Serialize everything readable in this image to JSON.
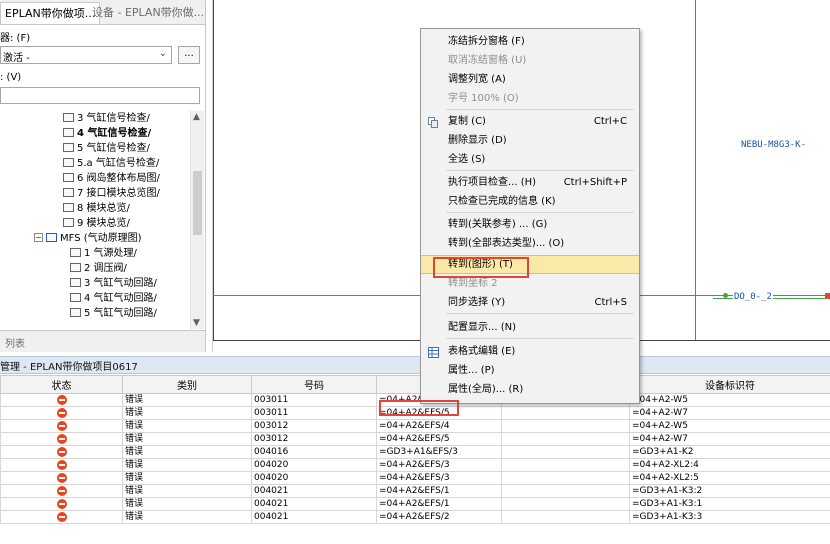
{
  "nav": {
    "tab_active": "EPLAN带你做项...",
    "tab_inactive": "设备 - EPLAN带你做...",
    "filter_label": "器: (F)",
    "filter_value": "激活 -",
    "filter_button": "...",
    "value_label": ": (V)",
    "value_input": "",
    "tree": [
      {
        "label": "3 气缸信号检查/",
        "bold": false,
        "icon": "page-icon"
      },
      {
        "label": "4 气缸信号检查/",
        "bold": true,
        "icon": "page-icon"
      },
      {
        "label": "5 气缸信号检查/",
        "bold": false,
        "icon": "page-icon"
      },
      {
        "label": "5.a 气缸信号检查/",
        "bold": false,
        "icon": "page-icon"
      },
      {
        "label": "6 阀岛整体布局图/",
        "bold": false,
        "icon": "grid-page-icon"
      },
      {
        "label": "7 接口模块总览图/",
        "bold": false,
        "icon": "grid-page-icon"
      },
      {
        "label": "8 模块总览/",
        "bold": false,
        "icon": "grid-page-icon"
      },
      {
        "label": "9 模块总览/",
        "bold": false,
        "icon": "grid-page-icon"
      },
      {
        "label": "MFS (气动原理图)",
        "bold": false,
        "icon": "structure-icon",
        "group": true
      },
      {
        "label": "1 气源处理/",
        "bold": false,
        "icon": "page-icon"
      },
      {
        "label": "2 调压阀/",
        "bold": false,
        "icon": "page-icon"
      },
      {
        "label": "3 气缸气动回路/",
        "bold": false,
        "icon": "page-icon"
      },
      {
        "label": "4 气缸气动回路/",
        "bold": false,
        "icon": "page-icon"
      },
      {
        "label": "5 气缸气动回路/",
        "bold": false,
        "icon": "page-icon"
      }
    ],
    "bottom_tab": "列表"
  },
  "canvas": {
    "device_label": "NEBU-M8G3-K-",
    "line_label": "DO_0-_2"
  },
  "messages": {
    "title": "管理 - EPLAN带你做项目0617",
    "columns": [
      "状态",
      "类别",
      "号码",
      "",
      "",
      "设备标识符"
    ],
    "rows": [
      {
        "category": "错误",
        "number": "003011",
        "text": "=04+A2&EFS/4",
        "device": "=04+A2-W5"
      },
      {
        "category": "错误",
        "number": "003011",
        "text": "=04+A2&EFS/5",
        "device": "=04+A2-W7"
      },
      {
        "category": "错误",
        "number": "003012",
        "text": "=04+A2&EFS/4",
        "device": "=04+A2-W5"
      },
      {
        "category": "错误",
        "number": "003012",
        "text": "=04+A2&EFS/5",
        "device": "=04+A2-W7"
      },
      {
        "category": "错误",
        "number": "004016",
        "text": "=GD3+A1&EFS/3",
        "device": "=GD3+A1-K2"
      },
      {
        "category": "错误",
        "number": "004020",
        "text": "=04+A2&EFS/3",
        "device": "=04+A2-XL2:4"
      },
      {
        "category": "错误",
        "number": "004020",
        "text": "=04+A2&EFS/3",
        "device": "=04+A2-XL2:5"
      },
      {
        "category": "错误",
        "number": "004021",
        "text": "=04+A2&EFS/1",
        "device": "=GD3+A1-K3:2"
      },
      {
        "category": "错误",
        "number": "004021",
        "text": "=04+A2&EFS/1",
        "device": "=GD3+A1-K3:1"
      },
      {
        "category": "错误",
        "number": "004021",
        "text": "=04+A2&EFS/2",
        "device": "=GD3+A1-K3:3"
      }
    ]
  },
  "context_menu": {
    "items": [
      {
        "label": "冻结拆分窗格 (F)",
        "disabled": false
      },
      {
        "label": "取消冻结窗格 (U)",
        "disabled": true
      },
      {
        "label": "调整列宽 (A)",
        "disabled": false
      },
      {
        "label": "字号 100% (O)",
        "disabled": true
      },
      {
        "label": "复制 (C)",
        "shortcut": "Ctrl+C",
        "icon": "copy-icon"
      },
      {
        "label": "删除显示 (D)"
      },
      {
        "label": "全选 (S)"
      },
      {
        "label": "执行项目检查... (H)",
        "shortcut": "Ctrl+Shift+P"
      },
      {
        "label": "只检查已完成的信息 (K)"
      },
      {
        "label": "转到(关联参考) ... (G)"
      },
      {
        "label": "转到(全部表达类型)... (O)"
      },
      {
        "label": "转到(图形) (T)",
        "selected": true
      },
      {
        "label": "转到坐标 2",
        "disabled": true
      },
      {
        "label": "同步选择 (Y)",
        "shortcut": "Ctrl+S"
      },
      {
        "label": "配置显示... (N)"
      },
      {
        "label": "表格式编辑 (E)",
        "icon": "table-edit-icon"
      },
      {
        "label": "属性... (P)"
      },
      {
        "label": "属性(全局)... (R)"
      }
    ]
  },
  "colors": {
    "accent_highlight": "#fbe9a8",
    "annotation_red": "#e0453a",
    "error_icon": "#e8441e",
    "cad_text": "#1b4fa8"
  }
}
